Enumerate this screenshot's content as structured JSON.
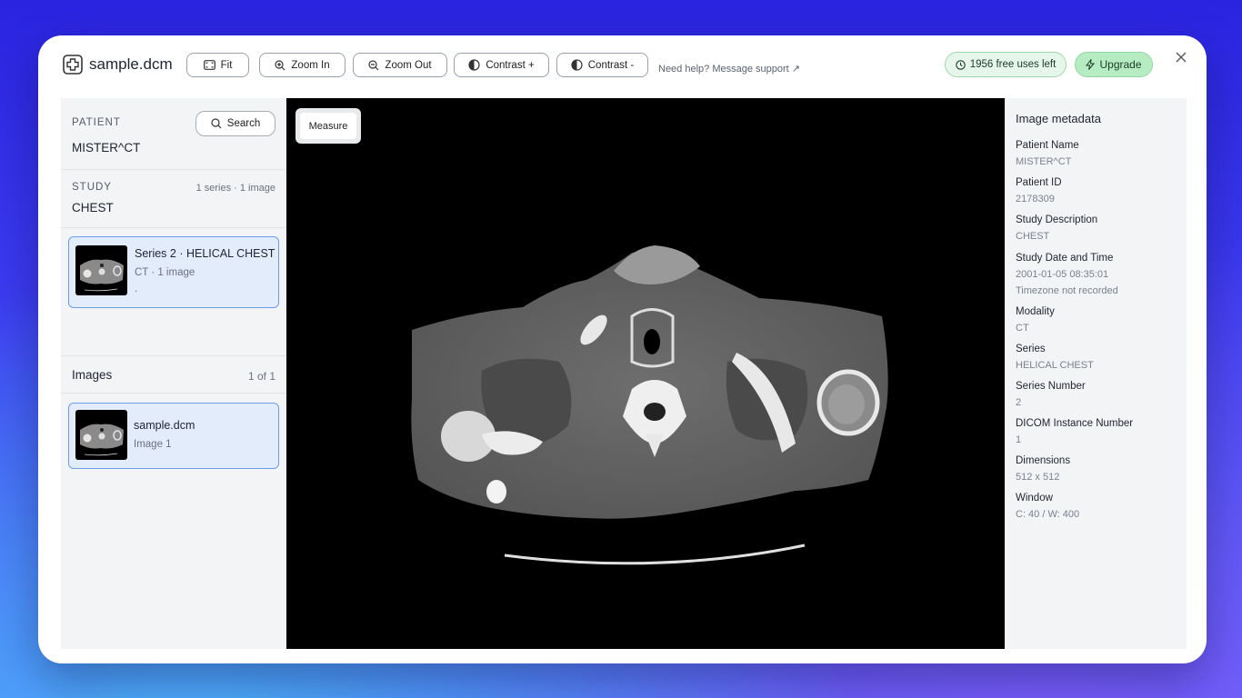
{
  "window": {
    "filename": "sample.dcm",
    "icon": "medical-cross-icon"
  },
  "toolbar": {
    "fit": "Fit",
    "zoom_in": "Zoom In",
    "zoom_out": "Zoom Out",
    "contrast_plus": "Contrast +",
    "contrast_minus": "Contrast -",
    "help": "Need help? Message support ↗",
    "free_uses": "1956 free uses left",
    "upgrade": "Upgrade"
  },
  "patient": {
    "label": "PATIENT",
    "name": "MISTER^CT",
    "search": "Search"
  },
  "study": {
    "label": "STUDY",
    "name": "CHEST",
    "count": "1 series · 1 image"
  },
  "series": {
    "title": "Series 2 · HELICAL CHEST",
    "subtitle": "CT · 1 image",
    "extra": "."
  },
  "images": {
    "heading": "Images",
    "count": "1 of 1",
    "items": [
      {
        "name": "sample.dcm",
        "sub": "Image 1"
      }
    ]
  },
  "viewer": {
    "measure": "Measure"
  },
  "metadata": {
    "title": "Image metadata",
    "fields": [
      {
        "label": "Patient Name",
        "value": "MISTER^CT"
      },
      {
        "label": "Patient ID",
        "value": "2178309"
      },
      {
        "label": "Study Description",
        "value": "CHEST"
      },
      {
        "label": "Study Date and Time",
        "value": "2001-01-05 08:35:01",
        "value2": "Timezone not recorded"
      },
      {
        "label": "Modality",
        "value": "CT"
      },
      {
        "label": "Series",
        "value": "HELICAL CHEST"
      },
      {
        "label": "Series Number",
        "value": "2"
      },
      {
        "label": "DICOM Instance Number",
        "value": "1"
      },
      {
        "label": "Dimensions",
        "value": "512 x 512"
      },
      {
        "label": "Window",
        "value": "C: 40 / W: 400"
      }
    ]
  },
  "colors": {
    "accent_border": "#6a9df0",
    "card_bg": "#e3ecfb",
    "green_pill": "#e6f6ea",
    "upgrade_bg": "#b6ecc2"
  }
}
